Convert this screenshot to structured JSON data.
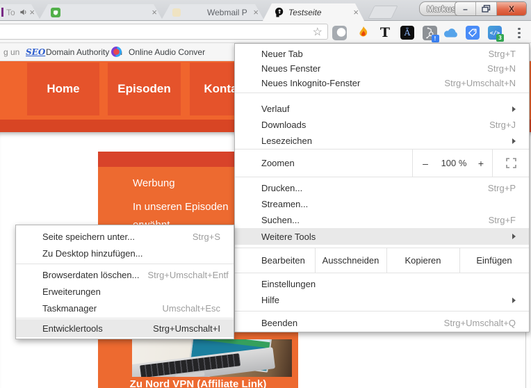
{
  "window": {
    "profile_label": "Markus",
    "minimize_glyph": "–",
    "close_glyph": "X"
  },
  "tabs": {
    "tab1_label": "To",
    "tab3_label": "Webmail P",
    "tab4_label": "Testseite",
    "close_glyph": "×"
  },
  "toolbar": {
    "t_letter_glyph": "T",
    "a_letter_glyph": "Ā",
    "code_glyph": "</>",
    "hubspot_badge": "!",
    "devtools_badge": "3"
  },
  "bookmarks": {
    "item1": "g un",
    "seo_label": "SEO",
    "item2": "Domain Authority Ch",
    "item3": "Online Audio Conver"
  },
  "site": {
    "nav": [
      "Home",
      "Episoden",
      "Kontakt"
    ],
    "card_title": "Werbung",
    "card_line1": "In unseren Episoden",
    "card_line2": "erwähnt",
    "card_link": "Zu Nord VPN (Affiliate Link)"
  },
  "menu": {
    "items": [
      {
        "label": "Neuer Tab",
        "shortcut": "Strg+T"
      },
      {
        "label": "Neues Fenster",
        "shortcut": "Strg+N"
      },
      {
        "label": "Neues Inkognito-Fenster",
        "shortcut": "Strg+Umschalt+N"
      },
      {
        "label": "Verlauf"
      },
      {
        "label": "Downloads",
        "shortcut": "Strg+J"
      },
      {
        "label": "Lesezeichen"
      },
      {
        "label": "Drucken...",
        "shortcut": "Strg+P"
      },
      {
        "label": "Streamen..."
      },
      {
        "label": "Suchen...",
        "shortcut": "Strg+F"
      },
      {
        "label": "Weitere Tools"
      },
      {
        "label": "Einstellungen"
      },
      {
        "label": "Hilfe"
      },
      {
        "label": "Beenden",
        "shortcut": "Strg+Umschalt+Q"
      }
    ],
    "zoom": {
      "label": "Zoomen",
      "minus": "–",
      "value": "100 %",
      "plus": "+"
    },
    "edit": {
      "label": "Bearbeiten",
      "cut": "Ausschneiden",
      "copy": "Kopieren",
      "paste": "Einfügen"
    }
  },
  "submenu": {
    "items": [
      {
        "label": "Seite speichern unter...",
        "shortcut": "Strg+S"
      },
      {
        "label": "Zu Desktop hinzufügen..."
      },
      {
        "label": "Browserdaten löschen...",
        "shortcut": "Strg+Umschalt+Entf"
      },
      {
        "label": "Erweiterungen"
      },
      {
        "label": "Taskmanager",
        "shortcut": "Umschalt+Esc"
      },
      {
        "label": "Entwicklertools",
        "shortcut": "Strg+Umschalt+I"
      }
    ]
  },
  "colors": {
    "header_orange": "#f0652d",
    "nav_button_orange": "#e5532b",
    "strip_red": "#d84524",
    "card_orange": "#ed6a30",
    "card_strip_red": "#d8432a",
    "close_button_red": "#d9553a",
    "badge_blue": "#3b82f4",
    "badge_green": "#34a853",
    "menu_highlight": "#e9e9e9"
  }
}
